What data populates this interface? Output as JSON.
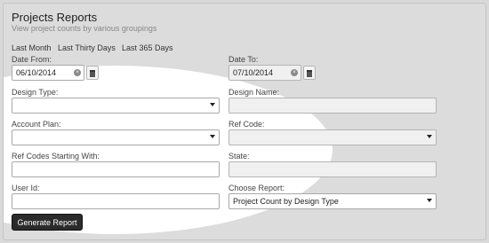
{
  "header": {
    "title": "Projects Reports",
    "subtitle": "View project counts by various groupings"
  },
  "quick_ranges": [
    "Last Month",
    "Last Thirty Days",
    "Last 365 Days"
  ],
  "date_from": {
    "label": "Date From:",
    "value": "06/10/2014"
  },
  "date_to": {
    "label": "Date To:",
    "value": "07/10/2014"
  },
  "design_type": {
    "label": "Design Type:",
    "value": ""
  },
  "design_name": {
    "label": "Design Name:",
    "value": ""
  },
  "account_plan": {
    "label": "Account Plan:",
    "value": ""
  },
  "ref_code": {
    "label": "Ref Code:",
    "value": ""
  },
  "ref_codes_starting": {
    "label": "Ref Codes Starting With:",
    "value": ""
  },
  "state": {
    "label": "State:",
    "value": ""
  },
  "user_id": {
    "label": "User Id:",
    "value": ""
  },
  "choose_report": {
    "label": "Choose Report:",
    "value": "Project Count by Design Type"
  },
  "generate_button": "Generate Report",
  "icons": {
    "clear": "clear-icon",
    "calendar": "calendar-icon",
    "dropdown": "chevron-down-icon"
  }
}
